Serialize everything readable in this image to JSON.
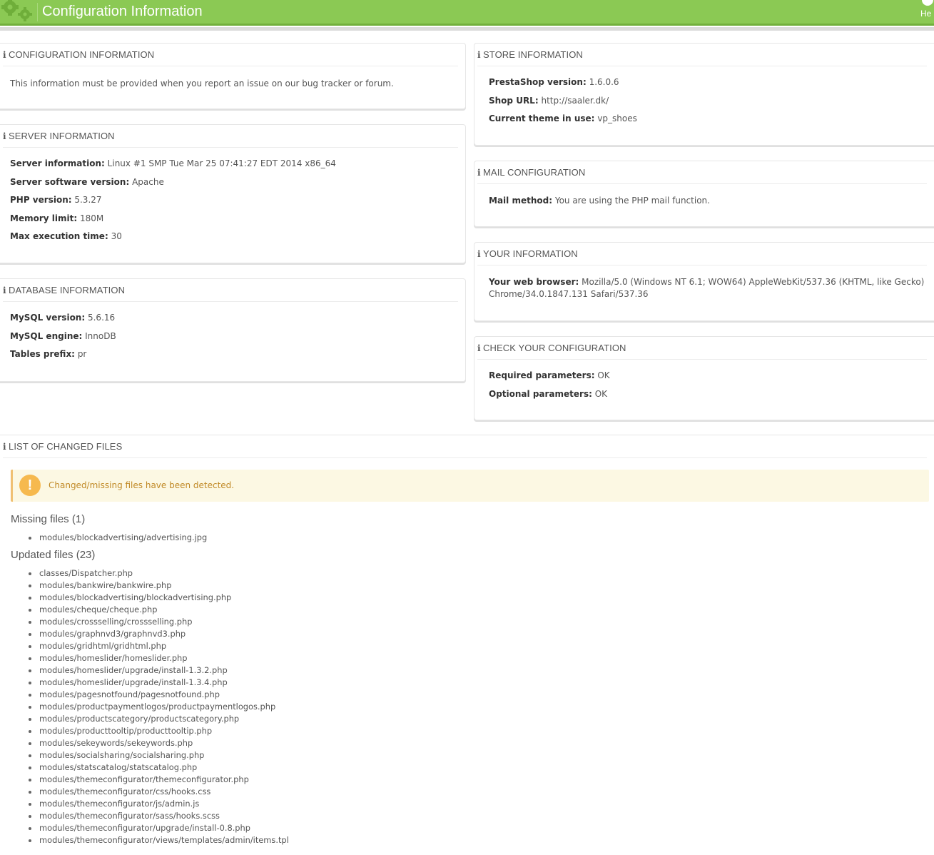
{
  "header": {
    "title": "Configuration Information",
    "help_label": "He",
    "icon": "gears-icon",
    "color": "#8bc954"
  },
  "configuration_panel": {
    "title": "CONFIGURATION INFORMATION",
    "text": "This information must be provided when you report an issue on our bug tracker or forum."
  },
  "server_panel": {
    "title": "SERVER INFORMATION",
    "rows": [
      {
        "label": "Server information:",
        "value": "Linux #1 SMP Tue Mar 25 07:41:27 EDT 2014 x86_64"
      },
      {
        "label": "Server software version:",
        "value": "Apache"
      },
      {
        "label": "PHP version:",
        "value": "5.3.27"
      },
      {
        "label": "Memory limit:",
        "value": "180M"
      },
      {
        "label": "Max execution time:",
        "value": "30"
      }
    ]
  },
  "database_panel": {
    "title": "DATABASE INFORMATION",
    "rows": [
      {
        "label": "MySQL version:",
        "value": "5.6.16"
      },
      {
        "label": "MySQL engine:",
        "value": "InnoDB"
      },
      {
        "label": "Tables prefix:",
        "value": "pr"
      }
    ]
  },
  "store_panel": {
    "title": "STORE INFORMATION",
    "rows": [
      {
        "label": "PrestaShop version:",
        "value": "1.6.0.6"
      },
      {
        "label": "Shop URL:",
        "value": "http://saaler.dk/"
      },
      {
        "label": "Current theme in use:",
        "value": "vp_shoes"
      }
    ]
  },
  "mail_panel": {
    "title": "MAIL CONFIGURATION",
    "rows": [
      {
        "label": "Mail method:",
        "value": "You are using the PHP mail function."
      }
    ]
  },
  "your_panel": {
    "title": "YOUR INFORMATION",
    "label": "Your web browser:",
    "value_line1": "Mozilla/5.0 (Windows NT 6.1; WOW64) AppleWebKit/537.36 (KHTML, like Gecko)",
    "value_line2": "Chrome/34.0.1847.131 Safari/537.36"
  },
  "check_panel": {
    "title": "CHECK YOUR CONFIGURATION",
    "rows": [
      {
        "label": "Required parameters:",
        "value": "OK"
      },
      {
        "label": "Optional parameters:",
        "value": "OK"
      }
    ]
  },
  "changed_files": {
    "title": "LIST OF CHANGED FILES",
    "warning": "Changed/missing files have been detected.",
    "warning_icon": "!",
    "missing_heading": "Missing files (1)",
    "missing": [
      "modules/blockadvertising/advertising.jpg"
    ],
    "updated_heading": "Updated files (23)",
    "updated": [
      "classes/Dispatcher.php",
      "modules/bankwire/bankwire.php",
      "modules/blockadvertising/blockadvertising.php",
      "modules/cheque/cheque.php",
      "modules/crossselling/crossselling.php",
      "modules/graphnvd3/graphnvd3.php",
      "modules/gridhtml/gridhtml.php",
      "modules/homeslider/homeslider.php",
      "modules/homeslider/upgrade/install-1.3.2.php",
      "modules/homeslider/upgrade/install-1.3.4.php",
      "modules/pagesnotfound/pagesnotfound.php",
      "modules/productpaymentlogos/productpaymentlogos.php",
      "modules/productscategory/productscategory.php",
      "modules/producttooltip/producttooltip.php",
      "modules/sekeywords/sekeywords.php",
      "modules/socialsharing/socialsharing.php",
      "modules/statscatalog/statscatalog.php",
      "modules/themeconfigurator/themeconfigurator.php",
      "modules/themeconfigurator/css/hooks.css",
      "modules/themeconfigurator/js/admin.js",
      "modules/themeconfigurator/sass/hooks.scss",
      "modules/themeconfigurator/upgrade/install-0.8.php",
      "modules/themeconfigurator/views/templates/admin/items.tpl"
    ]
  }
}
